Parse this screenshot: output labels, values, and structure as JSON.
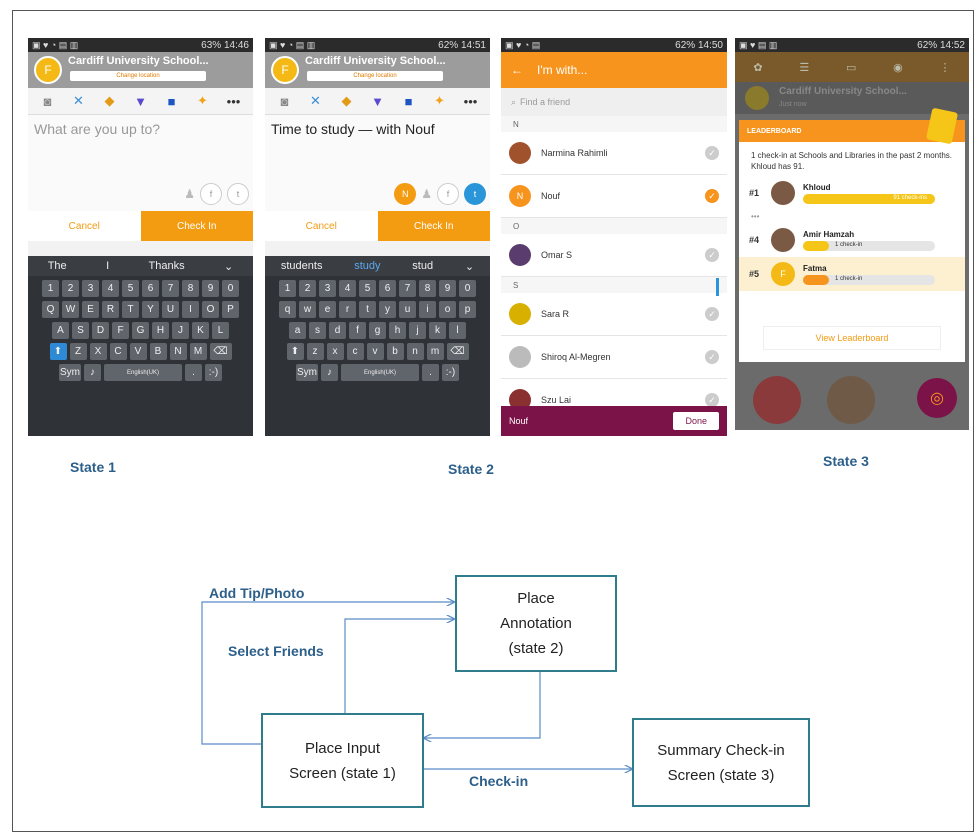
{
  "state1": {
    "time": "14:46",
    "battery": "63%",
    "place": "Cardiff University School...",
    "change_location": "Change location",
    "avatar_letter": "F",
    "placeholder": "What are you up to?",
    "cancel": "Cancel",
    "checkin": "Check In",
    "suggestions": [
      "The",
      "I",
      "Thanks"
    ],
    "sym": "Sym",
    "space": "English(UK)"
  },
  "state2": {
    "time": "14:51",
    "battery": "62%",
    "place": "Cardiff University School...",
    "change_location": "Change location",
    "avatar_letter": "F",
    "text_prefix": "Time to study — with ",
    "text_friend": "Nouf",
    "friend_badge": "N",
    "cancel": "Cancel",
    "checkin": "Check In",
    "suggestions": [
      "students",
      "study",
      "stud"
    ],
    "sym": "Sym",
    "space": "English(UK)"
  },
  "friends": {
    "time": "14:50",
    "battery": "62%",
    "title": "I'm with...",
    "search_placeholder": "Find a friend",
    "sections": [
      {
        "letter": "N",
        "items": [
          {
            "name": "Narmina Rahimli",
            "selected": false
          },
          {
            "name": "Nouf",
            "selected": true,
            "initial": "N"
          }
        ]
      },
      {
        "letter": "O",
        "items": [
          {
            "name": "Omar S",
            "selected": false
          }
        ]
      },
      {
        "letter": "S",
        "items": [
          {
            "name": "Sara R",
            "selected": false
          },
          {
            "name": "Shiroq Al-Megren",
            "selected": false
          },
          {
            "name": "Szu Lai",
            "selected": false
          }
        ]
      }
    ],
    "footer_name": "Nouf",
    "done": "Done"
  },
  "state3": {
    "time": "14:52",
    "battery": "62%",
    "place": "Cardiff University School...",
    "just_now": "Just now",
    "leaderboard_title": "LEADERBOARD",
    "summary": "1 check-in at Schools and Libraries in the past 2 months. Khloud has 91.",
    "ellipsis": "•••",
    "entries": [
      {
        "rank": "#1",
        "name": "Khloud",
        "checkins": "91 check-ins",
        "fill": 1.0,
        "initial": ""
      },
      {
        "rank": "#4",
        "name": "Amir Hamzah",
        "checkins": "1 check-in",
        "fill": 0.2,
        "initial": ""
      },
      {
        "rank": "#5",
        "name": "Fatma",
        "checkins": "1 check-in",
        "fill": 0.2,
        "initial": "F"
      }
    ],
    "view_button": "View Leaderboard"
  },
  "labels": {
    "state1": "State 1",
    "state2": "State 2",
    "state3": "State 3"
  },
  "diagram": {
    "nodes": {
      "place_annotation": "Place\nAnnotation\n(state 2)",
      "place_input": "Place Input\nScreen (state 1)",
      "summary": "Summary Check-in\nScreen (state 3)"
    },
    "edges": {
      "add_tip": "Add Tip/Photo",
      "select_friends": "Select Friends",
      "checkin": "Check-in"
    }
  }
}
